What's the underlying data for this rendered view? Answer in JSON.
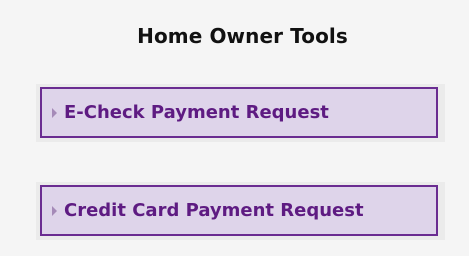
{
  "panel": {
    "title": "Home Owner Tools",
    "buttons": [
      {
        "label": "E-Check Payment Request",
        "icon": "triangle-right-icon"
      },
      {
        "label": "Credit Card Payment Request",
        "icon": "triangle-right-icon"
      }
    ]
  },
  "colors": {
    "button_border": "#6a2c91",
    "button_fill": "#ded4ea",
    "button_text": "#5e1b82",
    "arrow": "#a58ab8",
    "panel_bg": "#f5f5f5"
  }
}
